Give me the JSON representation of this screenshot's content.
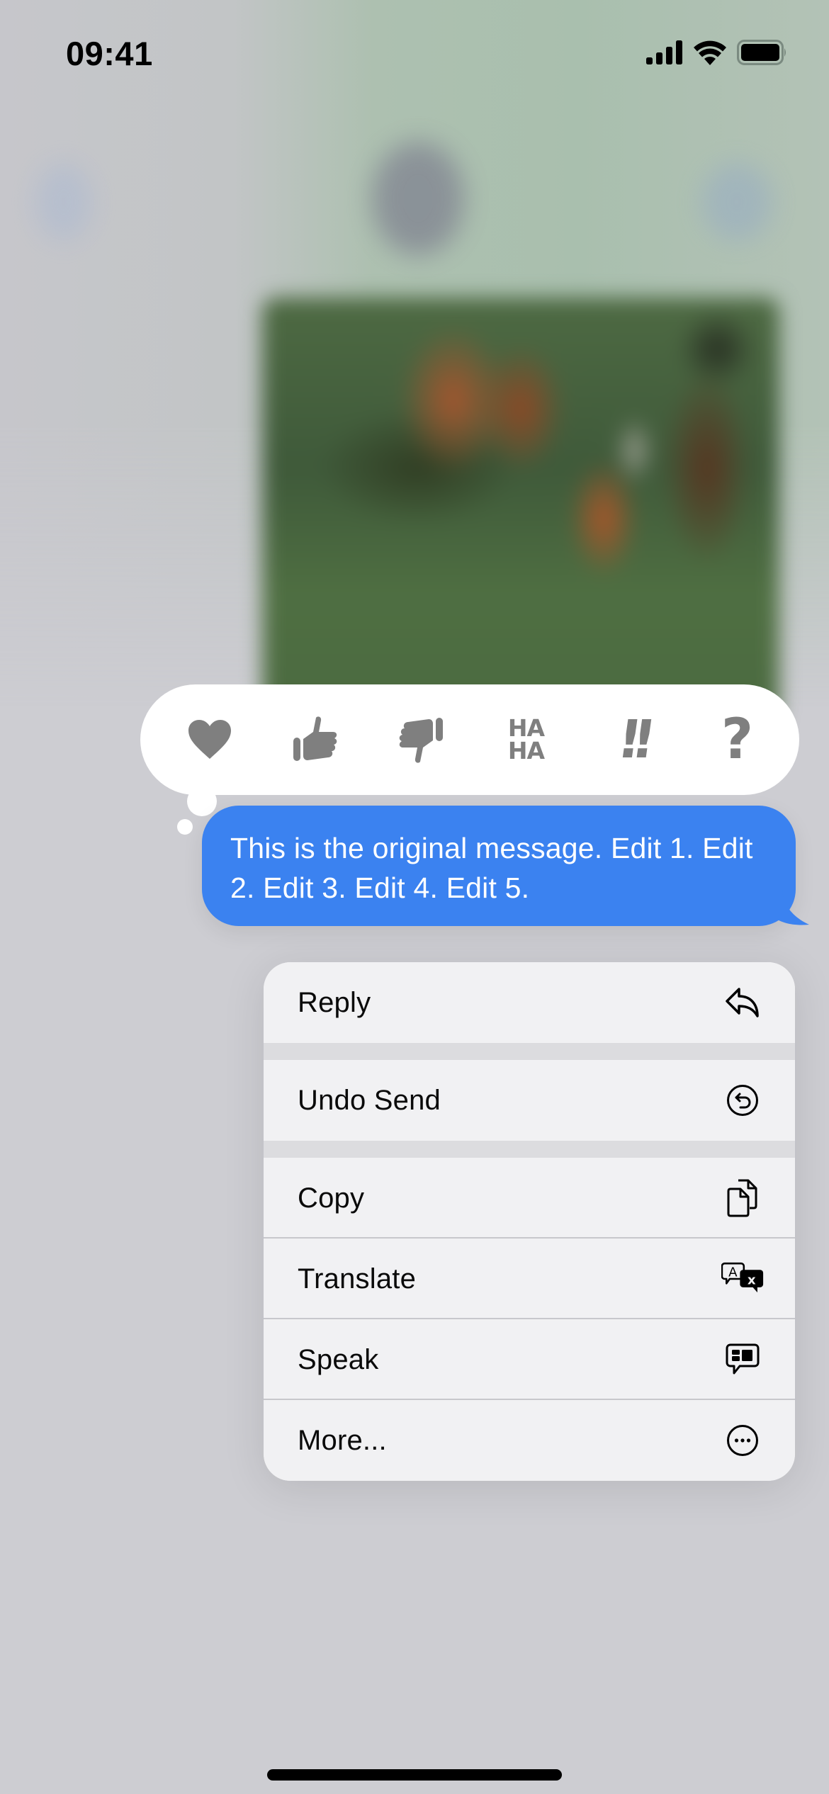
{
  "status_bar": {
    "time": "09:41",
    "icons": [
      "cellular-signal-icon",
      "wifi-icon",
      "battery-icon"
    ]
  },
  "background": {
    "header_icons": [
      "back-icon",
      "contact-avatar",
      "video-call-icon"
    ],
    "attachment": "blurred-photo"
  },
  "tapback": {
    "reactions": [
      {
        "name": "heart",
        "icon": "heart-icon"
      },
      {
        "name": "thumbs-up",
        "icon": "thumbs-up-icon"
      },
      {
        "name": "thumbs-down",
        "icon": "thumbs-down-icon"
      },
      {
        "name": "haha",
        "icon": "haha-icon",
        "line1": "HA",
        "line2": "HA"
      },
      {
        "name": "emphasize",
        "icon": "double-exclamation-icon",
        "glyph": "!!"
      },
      {
        "name": "question",
        "icon": "question-mark-icon",
        "glyph": "?"
      }
    ]
  },
  "message": {
    "text": "This is the original message. Edit 1. Edit 2. Edit 3. Edit 4. Edit 5.",
    "bubble_color": "#3b82f0"
  },
  "context_menu": {
    "items": [
      {
        "label": "Reply",
        "icon": "reply-arrow-icon"
      },
      {
        "label": "Undo Send",
        "icon": "undo-send-icon"
      },
      {
        "label": "Copy",
        "icon": "copy-documents-icon"
      },
      {
        "label": "Translate",
        "icon": "translate-icon"
      },
      {
        "label": "Speak",
        "icon": "speak-bubble-icon"
      },
      {
        "label": "More...",
        "icon": "more-ellipsis-icon"
      }
    ]
  }
}
